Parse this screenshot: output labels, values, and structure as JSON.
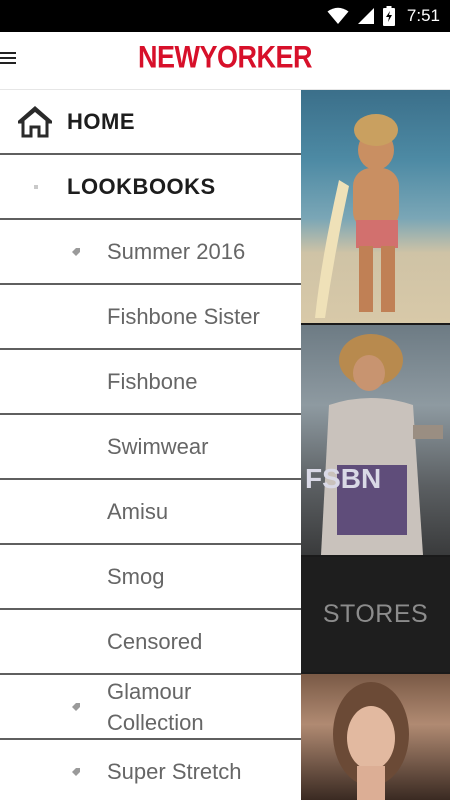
{
  "status_bar": {
    "time": "7:51",
    "icons": [
      "wifi-icon",
      "cell-signal-icon",
      "battery-charging-icon"
    ]
  },
  "app_bar": {
    "logo_text": "NEWYORKER",
    "menu_icon": "hamburger-menu-icon"
  },
  "colors": {
    "brand_red": "#d7102a",
    "divider": "#5f5f5f",
    "sub_text": "#666666"
  },
  "drawer": {
    "items": [
      {
        "label": "HOME",
        "icon": "home-icon"
      },
      {
        "label": "LOOKBOOKS",
        "icon": "bullet-icon"
      }
    ],
    "sub_items": [
      {
        "label": "Summer 2016",
        "icon": "tag-icon"
      },
      {
        "label": "Fishbone Sister",
        "icon": ""
      },
      {
        "label": "Fishbone",
        "icon": ""
      },
      {
        "label": "Swimwear",
        "icon": ""
      },
      {
        "label": "Amisu",
        "icon": ""
      },
      {
        "label": "Smog",
        "icon": ""
      },
      {
        "label": "Censored",
        "icon": ""
      },
      {
        "label": "Glamour Collection",
        "icon": "tag-icon"
      },
      {
        "label": "Super Stretch",
        "icon": "tag-icon"
      }
    ]
  },
  "content": {
    "stores_label": "STORES",
    "shirt_print": "FSBN"
  }
}
